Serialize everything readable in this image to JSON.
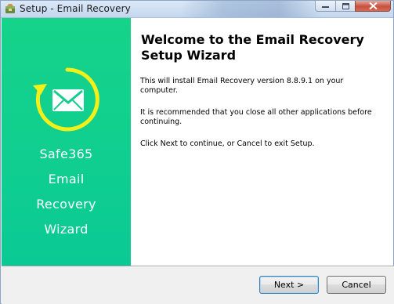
{
  "window": {
    "title": "Setup - Email Recovery"
  },
  "left_panel": {
    "lines": [
      "Safe365",
      "Email",
      "Recovery",
      "Wizard"
    ],
    "colors": {
      "top": "#16d38a",
      "bottom": "#0bc995",
      "ring": "#f3ef18"
    },
    "logo_icon": "envelope-refresh-icon"
  },
  "main": {
    "heading": "Welcome to the Email Recovery Setup Wizard",
    "paragraphs": [
      "This will install Email Recovery version 8.8.9.1 on your computer.",
      "It is recommended that you close all other applications before continuing.",
      "Click Next to continue, or Cancel to exit Setup."
    ]
  },
  "buttons": {
    "next_label": "Next >",
    "cancel_label": "Cancel"
  }
}
